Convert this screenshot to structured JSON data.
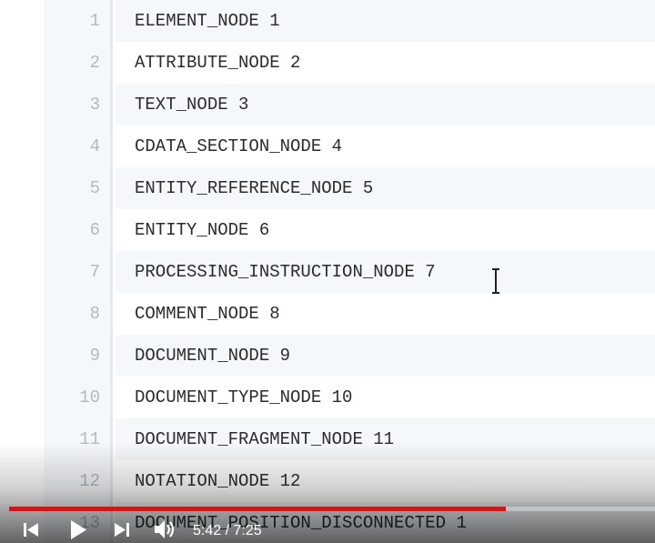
{
  "editor": {
    "lines": [
      {
        "number": "1",
        "code": "ELEMENT_NODE 1"
      },
      {
        "number": "2",
        "code": "ATTRIBUTE_NODE 2"
      },
      {
        "number": "3",
        "code": "TEXT_NODE 3"
      },
      {
        "number": "4",
        "code": "CDATA_SECTION_NODE 4"
      },
      {
        "number": "5",
        "code": "ENTITY_REFERENCE_NODE 5"
      },
      {
        "number": "6",
        "code": "ENTITY_NODE 6"
      },
      {
        "number": "7",
        "code": "PROCESSING_INSTRUCTION_NODE 7"
      },
      {
        "number": "8",
        "code": "COMMENT_NODE 8"
      },
      {
        "number": "9",
        "code": "DOCUMENT_NODE 9"
      },
      {
        "number": "10",
        "code": "DOCUMENT_TYPE_NODE 10"
      },
      {
        "number": "11",
        "code": "DOCUMENT_FRAGMENT_NODE 11"
      },
      {
        "number": "12",
        "code": "NOTATION_NODE 12"
      },
      {
        "number": "13",
        "code": "DOCUMENT_POSITION_DISCONNECTED 1"
      }
    ]
  },
  "player": {
    "current_time": "5:42",
    "separator": " / ",
    "duration": "7:25",
    "progress_fraction": 0.769,
    "progress_color": "#e01010",
    "icons": {
      "prev": "skip-previous-icon",
      "play": "play-icon",
      "next": "skip-next-icon",
      "volume": "volume-icon"
    }
  }
}
